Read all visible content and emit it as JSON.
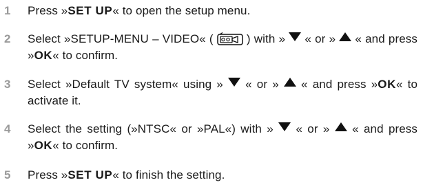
{
  "steps": [
    {
      "number": "1",
      "press": "Press »",
      "btn": "SET UP",
      "rest": "« to open the setup menu."
    },
    {
      "number": "2",
      "a": "Select »SETUP-MENU – VIDEO« (",
      "b": ") with »",
      "c": "« or »",
      "d": "« and press »",
      "btn": "OK",
      "e": "« to confirm.",
      "icon": "video-camera-icon"
    },
    {
      "number": "3",
      "a": "Select »Default TV system« using »",
      "b": "« or »",
      "c": "« and press »",
      "btn": "OK",
      "d": "« to activate it."
    },
    {
      "number": "4",
      "a": "Select the setting (»NTSC« or »PAL«) with »",
      "b": "« or »",
      "c": "« and press »",
      "btn": "OK",
      "d": "« to confirm."
    },
    {
      "number": "5",
      "press": "Press »",
      "btn": "SET UP",
      "rest": "« to finish the setting."
    }
  ],
  "icons": {
    "down": "down-triangle-icon",
    "up": "up-triangle-icon"
  }
}
